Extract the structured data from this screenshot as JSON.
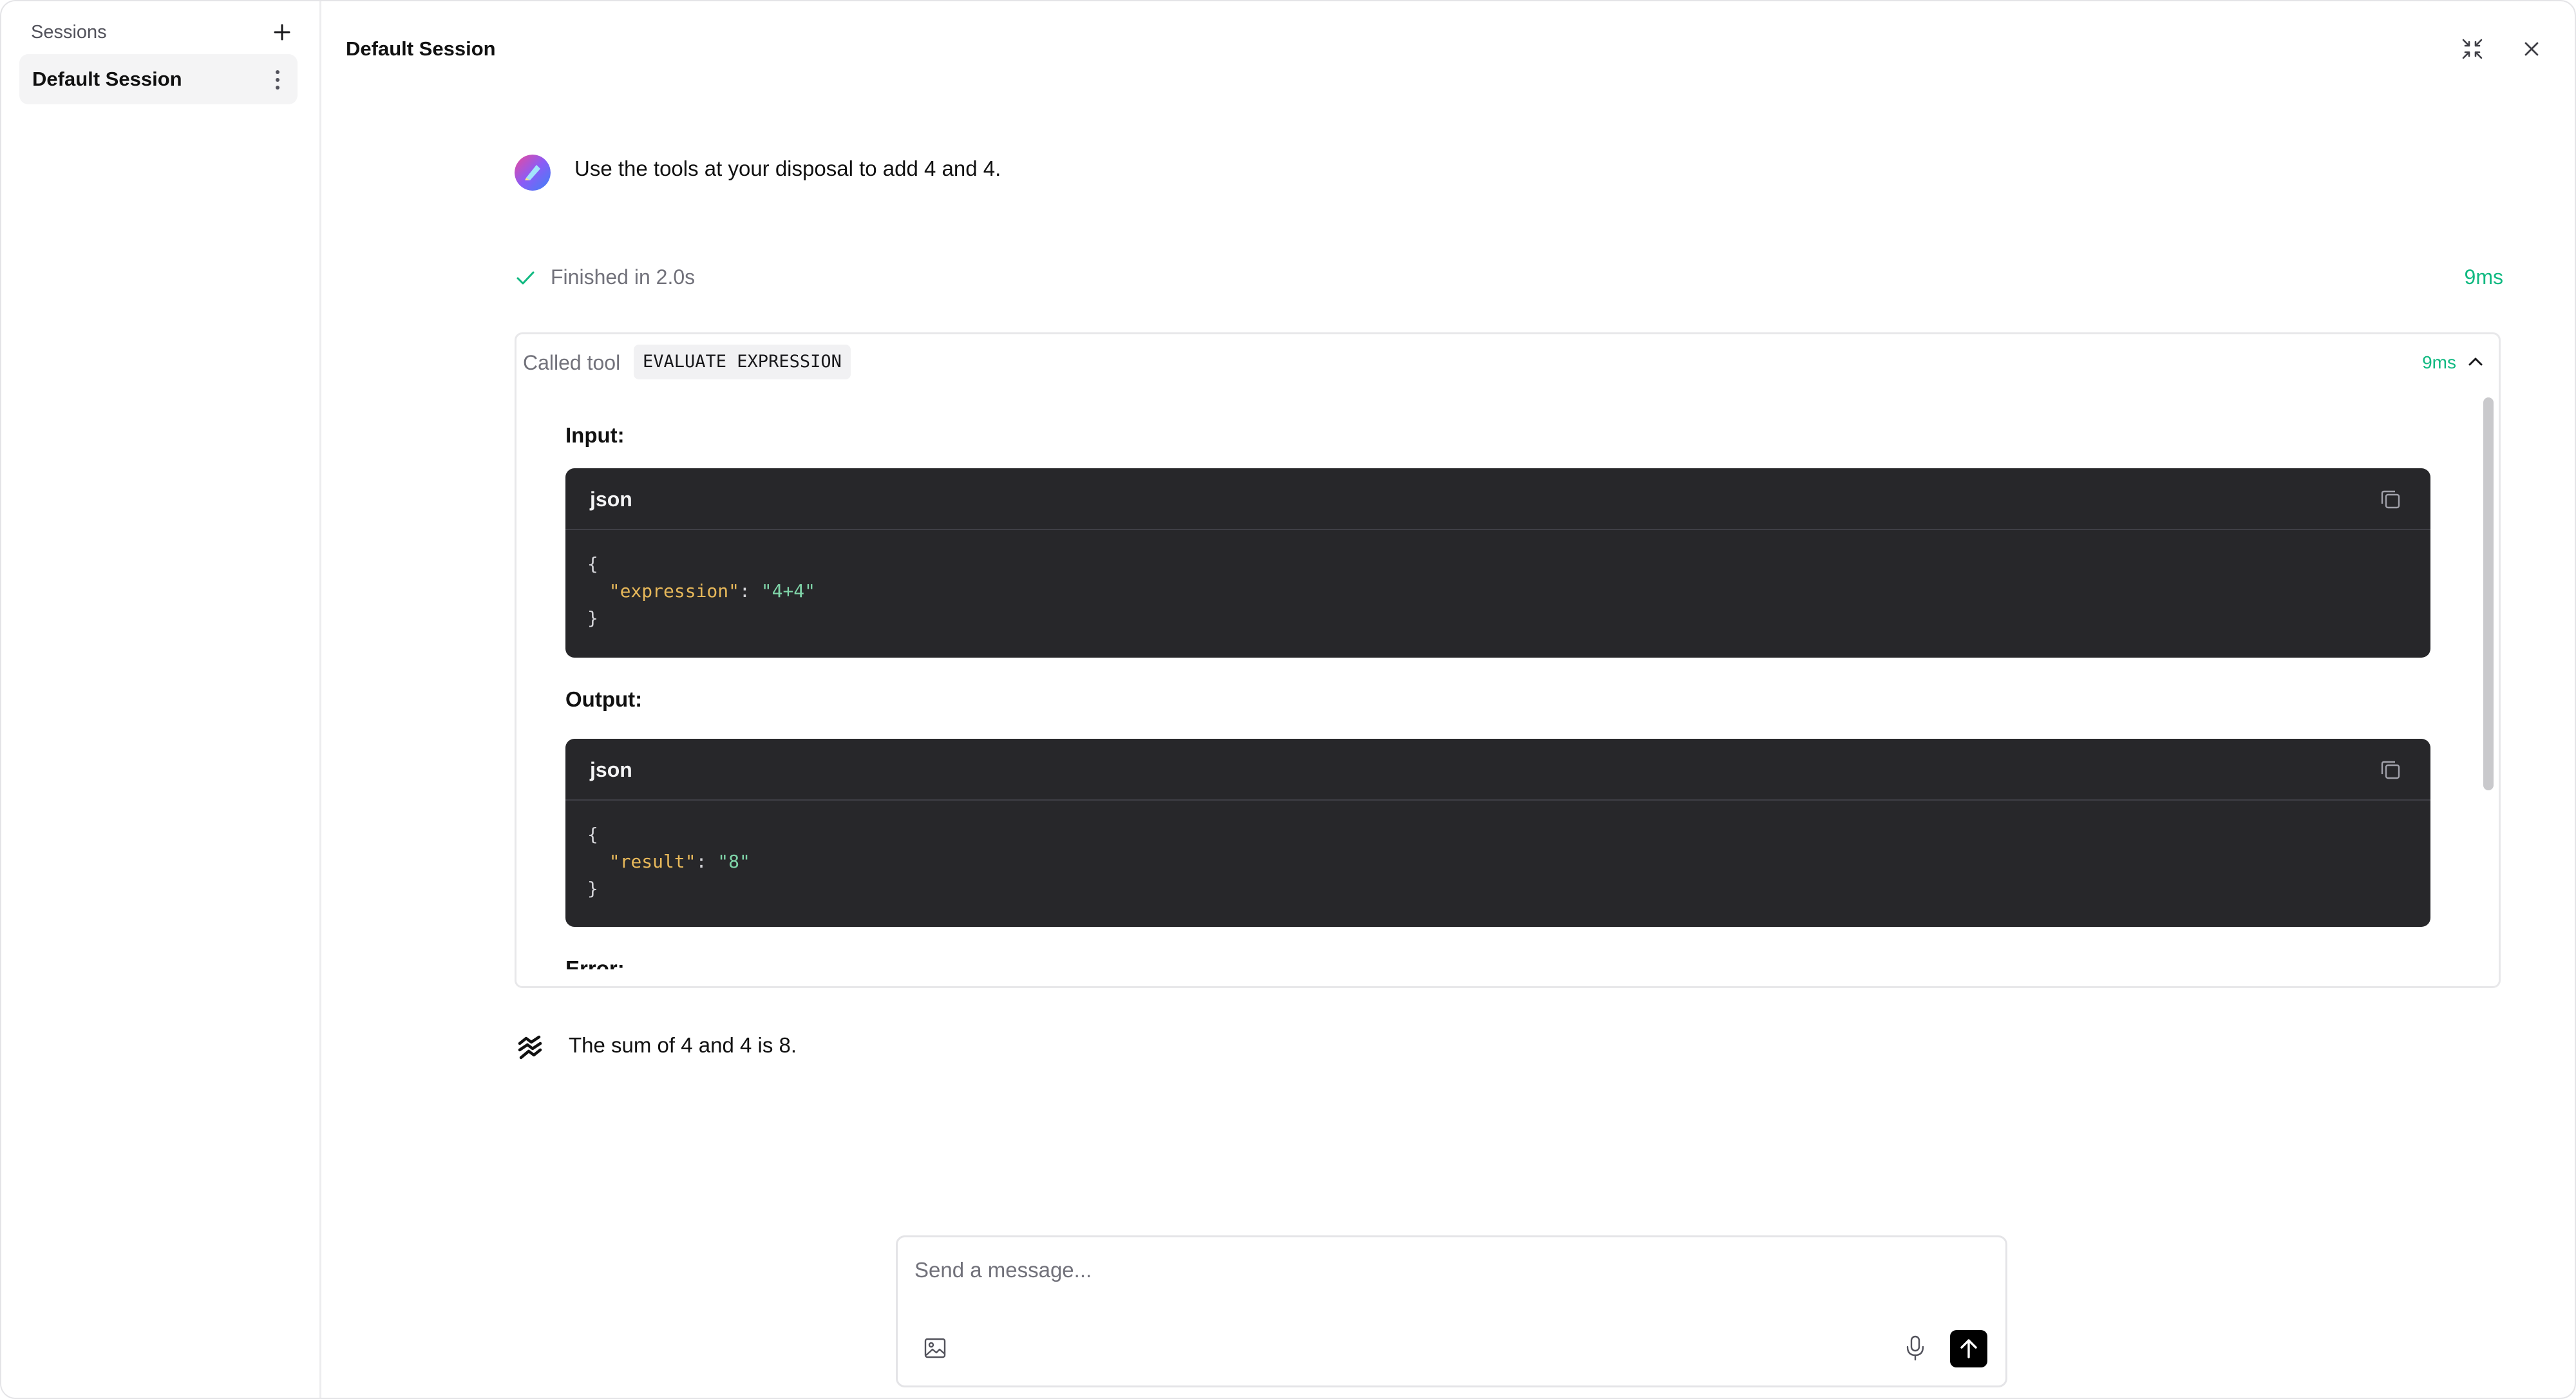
{
  "sidebar": {
    "title": "Sessions",
    "add_icon": "plus-icon",
    "sessions": [
      {
        "label": "Default Session",
        "menu_icon": "more-vertical-icon"
      }
    ]
  },
  "header": {
    "title": "Default Session",
    "minimize_icon": "minimize-icon",
    "close_icon": "close-icon"
  },
  "conversation": {
    "user_message": "Use the tools at your disposal to add 4 and 4.",
    "status": {
      "text": "Finished in 2.0s",
      "duration": "9ms",
      "icon": "check-icon"
    },
    "tool_call": {
      "prefix": "Called tool",
      "name": "EVALUATE EXPRESSION",
      "duration": "9ms",
      "toggle_icon": "chevron-up-icon",
      "input_label": "Input:",
      "input": {
        "lang": "json",
        "key": "\"expression\"",
        "value": "\"4+4\""
      },
      "output_label": "Output:",
      "output": {
        "lang": "json",
        "key": "\"result\"",
        "value": "\"8\""
      },
      "error_label": "Error:"
    },
    "assistant_message": "The sum of 4 and 4 is 8."
  },
  "composer": {
    "placeholder": "Send a message...",
    "image_icon": "image-icon",
    "mic_icon": "mic-icon",
    "send_icon": "arrow-up-icon"
  },
  "colors": {
    "accent_green": "#10b981",
    "code_bg": "#27272a",
    "json_key": "#e7b85a",
    "json_string": "#7fd4a8"
  }
}
